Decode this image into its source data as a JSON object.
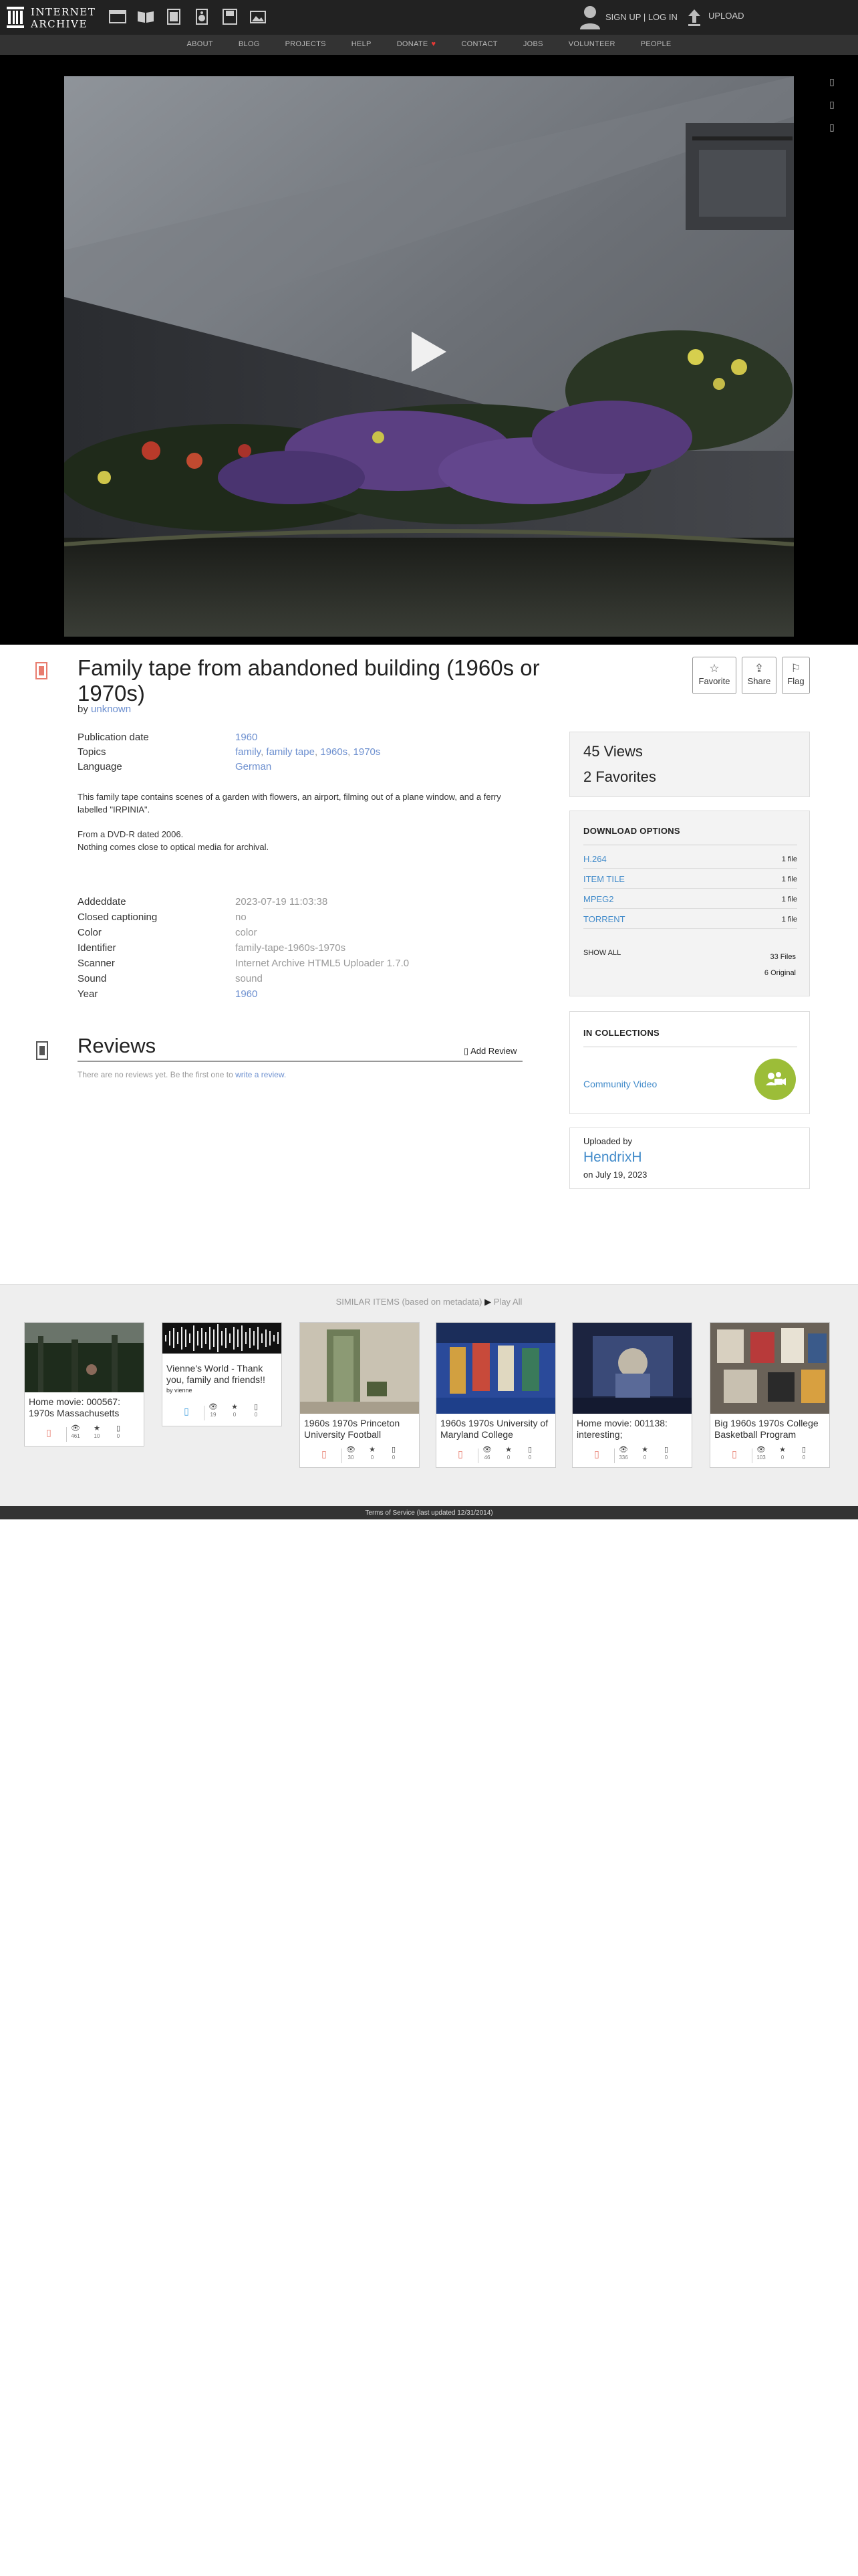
{
  "header": {
    "logo_line1": "INTERNET",
    "logo_line2": "ARCHIVE",
    "media_icons": [
      "web-icon",
      "texts-icon",
      "video-icon",
      "audio-icon",
      "software-icon",
      "images-icon"
    ],
    "signup_label": "SIGN UP | LOG IN",
    "upload_label": "UPLOAD"
  },
  "nav": {
    "items": [
      "ABOUT",
      "BLOG",
      "PROJECTS",
      "HELP",
      "DONATE",
      "CONTACT",
      "JOBS",
      "VOLUNTEER",
      "PEOPLE"
    ]
  },
  "player": {
    "side_icons": [
      "fullscreen-icon",
      "embed-icon",
      "info-icon"
    ]
  },
  "item": {
    "title": "Family tape from abandoned building (1960s or 1970s)",
    "by_label": "by",
    "creator": "unknown",
    "actions": {
      "favorite": "Favorite",
      "share": "Share",
      "flag": "Flag"
    }
  },
  "metadata": {
    "publication_date_label": "Publication date",
    "publication_date": "1960",
    "topics_label": "Topics",
    "topics": [
      "family",
      "family tape",
      "1960s",
      "1970s"
    ],
    "language_label": "Language",
    "language": "German",
    "description": [
      "This family tape contains scenes of a garden with flowers, an airport, filming out of a plane window, and a ferry labelled \"IRPINIA\".",
      "From a DVD-R dated 2006.",
      "Nothing comes close to optical media for archival."
    ],
    "details": [
      {
        "key": "Addeddate",
        "value": "2023-07-19 11:03:38",
        "link": false
      },
      {
        "key": "Closed captioning",
        "value": "no",
        "link": false
      },
      {
        "key": "Color",
        "value": "color",
        "link": false
      },
      {
        "key": "Identifier",
        "value": "family-tape-1960s-1970s",
        "link": false
      },
      {
        "key": "Scanner",
        "value": "Internet Archive HTML5 Uploader 1.7.0",
        "link": false
      },
      {
        "key": "Sound",
        "value": "sound",
        "link": false
      },
      {
        "key": "Year",
        "value": "1960",
        "link": true
      }
    ]
  },
  "reviews": {
    "title": "Reviews",
    "add_label": "Add Review",
    "empty_text": "There are no reviews yet. Be the first one to",
    "empty_link": "write a review."
  },
  "stats": {
    "views": "45 Views",
    "favorites": "2 Favorites"
  },
  "downloads": {
    "title": "DOWNLOAD OPTIONS",
    "options": [
      {
        "format": "H.264",
        "count": "1 file"
      },
      {
        "format": "ITEM TILE",
        "count": "1 file"
      },
      {
        "format": "MPEG2",
        "count": "1 file"
      },
      {
        "format": "TORRENT",
        "count": "1 file"
      }
    ],
    "show_all": "SHOW ALL",
    "files_total": "33 Files",
    "files_original": "6 Original"
  },
  "collections": {
    "title": "IN COLLECTIONS",
    "items": [
      "Community Video"
    ]
  },
  "uploader": {
    "label": "Uploaded by",
    "name": "HendrixH",
    "date": "on July 19, 2023"
  },
  "similar": {
    "heading": "SIMILAR ITEMS (based on metadata)",
    "play_all": "Play All",
    "cards": [
      {
        "title": "Home movie: 000567: 1970s Massachusetts",
        "by": "",
        "type": "video",
        "views": "461",
        "favs": "10",
        "reviews": "0"
      },
      {
        "title": "Vienne's World - Thank you, family and friends!!",
        "by": "by vienne",
        "type": "audio",
        "views": "19",
        "favs": "0",
        "reviews": "0"
      },
      {
        "title": "1960s 1970s Princeton University Football",
        "by": "",
        "type": "video",
        "views": "30",
        "favs": "0",
        "reviews": "0"
      },
      {
        "title": "1960s 1970s University of Maryland College",
        "by": "",
        "type": "video",
        "views": "46",
        "favs": "0",
        "reviews": "0"
      },
      {
        "title": "Home movie: 001138: interesting;",
        "by": "",
        "type": "video",
        "views": "336",
        "favs": "0",
        "reviews": "0"
      },
      {
        "title": "Big 1960s 1970s College Basketball Program",
        "by": "",
        "type": "video",
        "views": "103",
        "favs": "0",
        "reviews": "0"
      }
    ]
  },
  "footer": {
    "text": "Terms of Service (last updated 12/31/2014)"
  },
  "colors": {
    "topbar": "#222222",
    "navbar": "#333333",
    "link": "#428bca",
    "collection_badge": "#9cbd38",
    "donate_heart": "#e53935"
  }
}
